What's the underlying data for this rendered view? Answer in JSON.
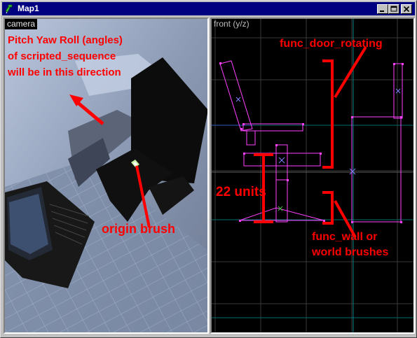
{
  "window": {
    "title": "Map1",
    "app_icon": "hammer-icon",
    "controls": [
      "minimize-icon",
      "maximize-icon",
      "close-icon"
    ]
  },
  "camera_view": {
    "label": "camera",
    "annotations": {
      "angles_line1": "Pitch Yaw Roll (angles)",
      "angles_line2": "of scripted_sequence",
      "angles_line3": "will be in this direction",
      "origin": "origin brush"
    }
  },
  "front_view": {
    "label": "front (y/z)",
    "annotations": {
      "door": "func_door_rotating",
      "units": "22 units",
      "wall_line1": "func_wall or",
      "wall_line2": "world brushes"
    }
  },
  "colors": {
    "annotation": "#ff0000",
    "brush_outline": "#ff40ff",
    "grid_major": "#008080",
    "grid_minor": "#404040",
    "title_bar": "#000080"
  }
}
